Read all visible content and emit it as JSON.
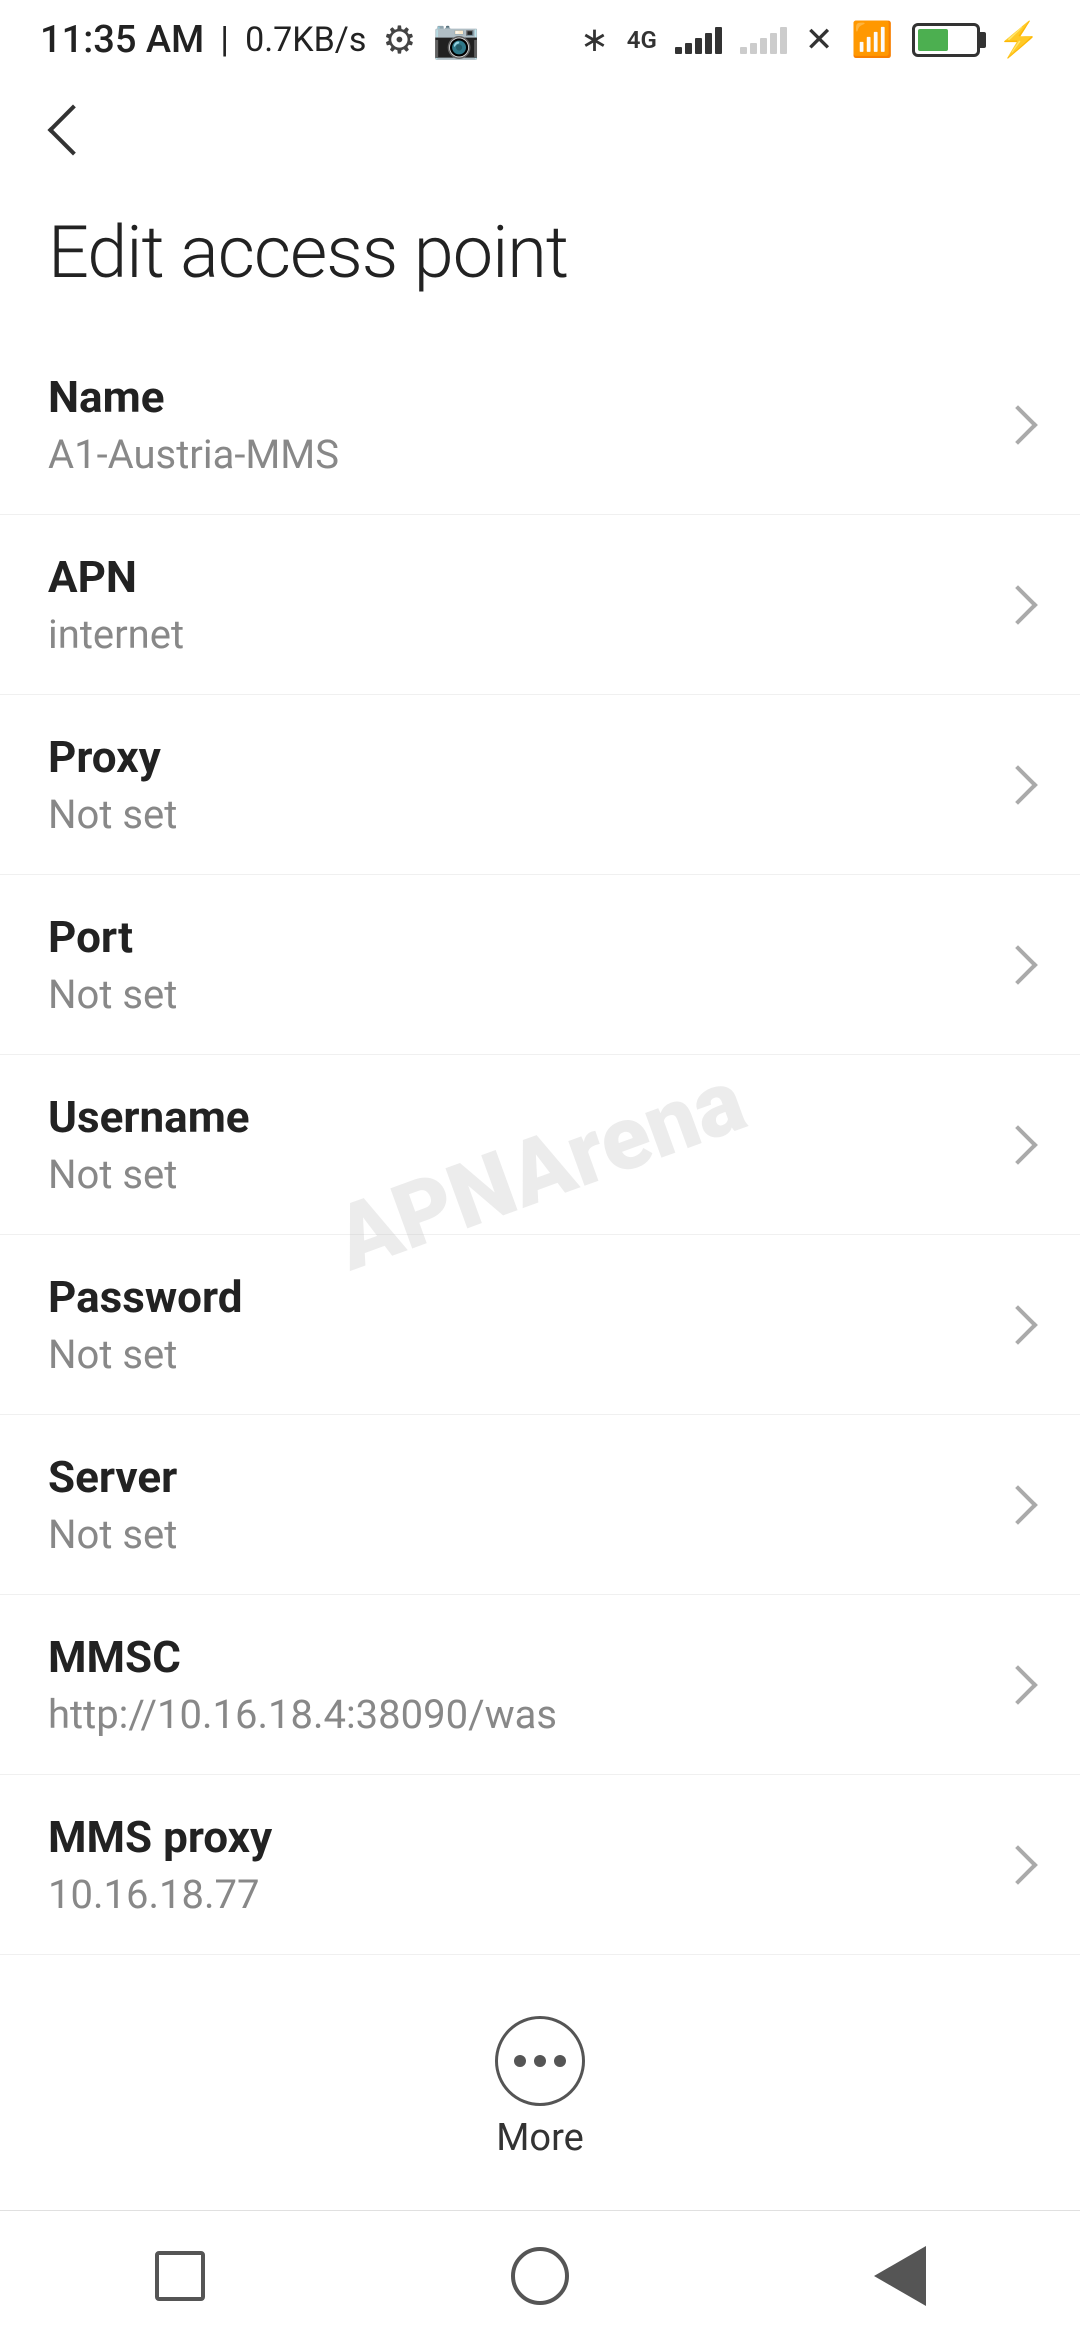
{
  "statusBar": {
    "time": "11:35 AM",
    "speed": "0.7KB/s"
  },
  "toolbar": {
    "back_label": "Back"
  },
  "page": {
    "title": "Edit access point"
  },
  "settings": {
    "items": [
      {
        "label": "Name",
        "value": "A1-Austria-MMS"
      },
      {
        "label": "APN",
        "value": "internet"
      },
      {
        "label": "Proxy",
        "value": "Not set"
      },
      {
        "label": "Port",
        "value": "Not set"
      },
      {
        "label": "Username",
        "value": "Not set"
      },
      {
        "label": "Password",
        "value": "Not set"
      },
      {
        "label": "Server",
        "value": "Not set"
      },
      {
        "label": "MMSC",
        "value": "http://10.16.18.4:38090/was"
      },
      {
        "label": "MMS proxy",
        "value": "10.16.18.77"
      }
    ]
  },
  "more": {
    "label": "More"
  },
  "watermark": {
    "line1": "APNArena"
  }
}
